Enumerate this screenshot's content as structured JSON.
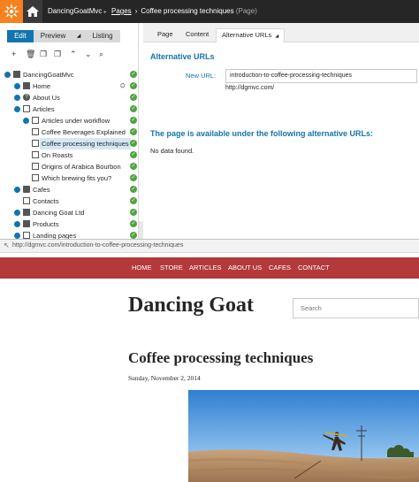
{
  "topbar": {
    "site_name": "DancingGoatMvc",
    "site_caret": "▸",
    "breadcrumb_pages": "Pages",
    "breadcrumb_sep": "›",
    "breadcrumb_current": "Coffee processing techniques",
    "breadcrumb_type": "(Page)"
  },
  "modes": {
    "edit": "Edit",
    "preview": "Preview",
    "dropdown": "◢",
    "listing": "Listing"
  },
  "toolbar": {
    "add": "+",
    "delete": "🗑",
    "copy": "❐",
    "move": "❐",
    "up": "⌃",
    "down": "⌄",
    "search": "⌕"
  },
  "tree": [
    {
      "label": "DancingGoatMvc"
    },
    {
      "label": "Home"
    },
    {
      "label": "About Us"
    },
    {
      "label": "Articles"
    },
    {
      "label": "Articles under workflow"
    },
    {
      "label": "Coffee Beverages Explained"
    },
    {
      "label": "Coffee processing techniques"
    },
    {
      "label": "On Roasts"
    },
    {
      "label": "Origins of Arabica Bourbon"
    },
    {
      "label": "Which brewing fits you?"
    },
    {
      "label": "Cafes"
    },
    {
      "label": "Contacts"
    },
    {
      "label": "Dancing Goat Ltd"
    },
    {
      "label": "Products"
    },
    {
      "label": "Landing pages"
    }
  ],
  "tabs": {
    "page": "Page",
    "content": "Content",
    "alt_urls": "Alternative URLs",
    "alt_caret": "◢"
  },
  "alt": {
    "section_title": "Alternative URLs",
    "new_url_label": "New URL:",
    "new_url_value": "introduction-to-coffee-processing-techniques",
    "new_url_hint": "http://dgmvc.com/",
    "available_title": "The page is available under the following alternative URLs:",
    "no_data": "No data found."
  },
  "address_bar": {
    "arrow": "↖",
    "url": "http://dgmvc.com/introduction-to-coffee-processing-techniques"
  },
  "site_preview": {
    "nav": [
      "HOME",
      "STORE",
      "ARTICLES",
      "ABOUT US",
      "CAFES",
      "CONTACT"
    ],
    "brand": "Dancing Goat",
    "search_placeholder": "Search",
    "article_title": "Coffee processing techniques",
    "article_date": "Sunday, November 2, 2014"
  },
  "colors": {
    "topbar": "#262626",
    "accent_blue": "#1175ae",
    "logo_orange": "#f5821f",
    "nav_red": "#b3393b",
    "published_green": "#4ea43f",
    "selected_row": "#d4e8f2"
  }
}
